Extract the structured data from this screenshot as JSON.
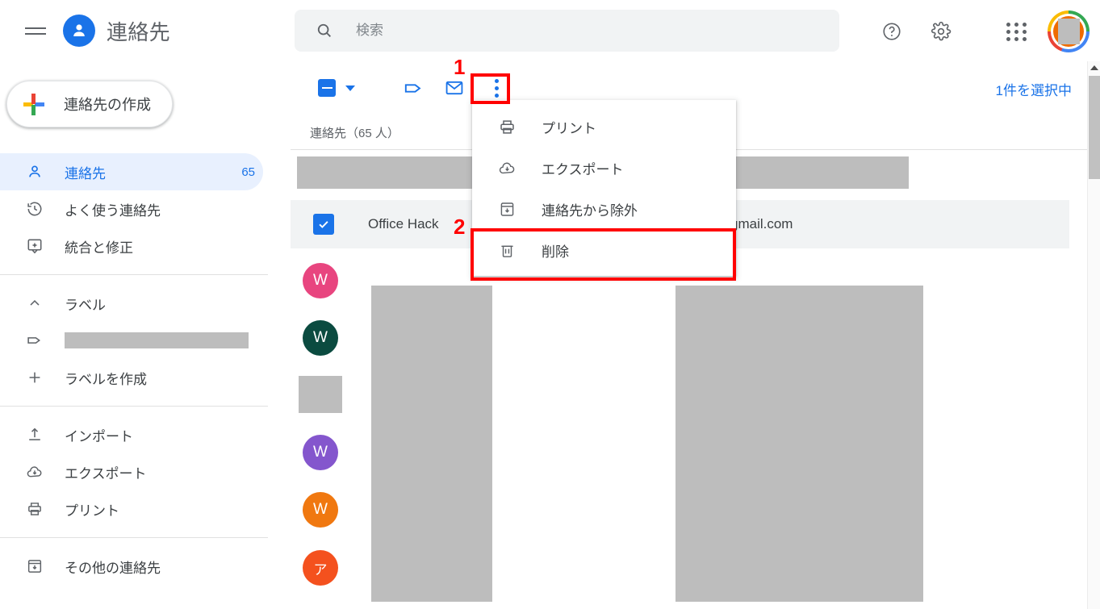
{
  "app": {
    "title": "連絡先",
    "menu_icon": "hamburger-icon",
    "brand_icon": "contacts-person-icon"
  },
  "create_button": {
    "label": "連絡先の作成",
    "icon": "google-plus-icon"
  },
  "sidebar": {
    "items": [
      {
        "label": "連絡先",
        "count": "65",
        "icon": "person-icon",
        "active": true
      },
      {
        "label": "よく使う連絡先",
        "count": "",
        "icon": "history-clock-icon",
        "active": false
      },
      {
        "label": "統合と修正",
        "count": "",
        "icon": "merge-fix-icon",
        "active": false
      }
    ],
    "labels_section": {
      "header": "ラベル",
      "header_icon": "chevron-up-icon",
      "redacted_label_icon": "label-tag-icon",
      "create_label": "ラベルを作成",
      "create_label_icon": "plus-icon"
    },
    "tools": [
      {
        "label": "インポート",
        "icon": "import-upload-icon"
      },
      {
        "label": "エクスポート",
        "icon": "export-cloud-download-icon"
      },
      {
        "label": "プリント",
        "icon": "printer-icon"
      }
    ],
    "other": [
      {
        "label": "その他の連絡先",
        "icon": "archive-box-icon"
      }
    ]
  },
  "search": {
    "placeholder": "検索",
    "value": "",
    "icon": "search-icon"
  },
  "header_actions": {
    "help_icon": "help-circle-icon",
    "settings_icon": "gear-icon",
    "apps_icon": "apps-grid-icon",
    "account_icon": "account-avatar"
  },
  "toolbar": {
    "select_all_icon": "indeterminate-checkbox-icon",
    "select_all_caret_icon": "chevron-down-icon",
    "label_icon": "label-tag-icon",
    "email_icon": "envelope-icon",
    "more_icon": "more-vertical-dots-icon",
    "selection_count": "1件を選択中"
  },
  "list": {
    "header": "連絡先（65 人）",
    "rows": [
      {
        "name": "",
        "email": "",
        "checked": false,
        "selected": false,
        "redacted": true,
        "avatar_letter": "",
        "avatar_color": "#bdbdbd"
      },
      {
        "name": "Office Hack",
        "email": "gmail.com",
        "checked": true,
        "selected": true,
        "redacted": false,
        "avatar_letter": "",
        "avatar_color": "#1a73e8"
      },
      {
        "name": "",
        "email": "",
        "checked": false,
        "selected": false,
        "redacted": true,
        "avatar_letter": "W",
        "avatar_color": "#e8457f"
      },
      {
        "name": "",
        "email": "",
        "checked": false,
        "selected": false,
        "redacted": true,
        "avatar_letter": "W",
        "avatar_color": "#0b4b40"
      },
      {
        "name": "",
        "email": "",
        "checked": false,
        "selected": false,
        "redacted": true,
        "avatar_letter": "",
        "avatar_color": "#bdbdbd"
      },
      {
        "name": "",
        "email": "",
        "checked": false,
        "selected": false,
        "redacted": true,
        "avatar_letter": "W",
        "avatar_color": "#8456cd"
      },
      {
        "name": "",
        "email": "",
        "checked": false,
        "selected": false,
        "redacted": true,
        "avatar_letter": "W",
        "avatar_color": "#f07810"
      },
      {
        "name": "",
        "email": "",
        "checked": false,
        "selected": false,
        "redacted": true,
        "avatar_letter": "ア",
        "avatar_color": "#f4511e"
      }
    ]
  },
  "context_menu": {
    "items": [
      {
        "label": "プリント",
        "icon": "printer-icon",
        "highlighted": false
      },
      {
        "label": "エクスポート",
        "icon": "export-cloud-download-icon",
        "highlighted": false
      },
      {
        "label": "連絡先から除外",
        "icon": "archive-box-icon",
        "highlighted": false
      },
      {
        "label": "削除",
        "icon": "trash-icon",
        "highlighted": true
      }
    ]
  },
  "annotations": {
    "marker_1": "1",
    "marker_2": "2",
    "color": "#ff0000"
  },
  "scrollbar": {
    "up_arrow_icon": "scroll-up-arrow-icon"
  },
  "colors": {
    "accent": "#1a73e8",
    "active_bg": "#e8f0fe",
    "text": "#3c4043",
    "muted": "#5f6368",
    "redaction": "#bdbdbd",
    "annotation": "#ff0000"
  }
}
